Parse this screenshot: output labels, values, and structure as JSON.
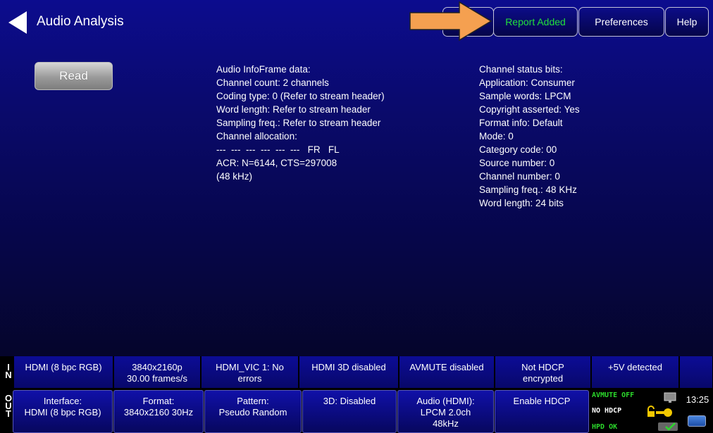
{
  "header": {
    "title": "Audio Analysis",
    "tabs": [
      {
        "label": ""
      },
      {
        "label": "Report Added"
      },
      {
        "label": "Preferences"
      },
      {
        "label": "Help"
      }
    ]
  },
  "read_button": "Read",
  "infoframe_lines": [
    "Audio InfoFrame data:",
    "Channel count: 2 channels",
    "Coding type: 0 (Refer to stream header)",
    "Word length: Refer to stream header",
    "Sampling freq.: Refer to stream header",
    "Channel allocation:",
    "---  ---  ---  ---  ---  ---   FR   FL",
    "ACR: N=6144, CTS=297008",
    "(48 kHz)"
  ],
  "channel_status_lines": [
    "Channel status bits:",
    "Application: Consumer",
    "Sample words: LPCM",
    "Copyright asserted: Yes",
    "Format info: Default",
    "Mode: 0",
    "Category code: 00",
    "Source number: 0",
    "Channel number: 0",
    "Sampling freq.: 48 KHz",
    "Word length: 24 bits"
  ],
  "in_bar": {
    "side_label": [
      "I",
      "N"
    ],
    "cells": [
      [
        "HDMI (8 bpc RGB)"
      ],
      [
        "3840x2160p",
        "30.00 frames/s"
      ],
      [
        "HDMI_VIC 1: No",
        "errors"
      ],
      [
        "HDMI 3D disabled"
      ],
      [
        "AVMUTE disabled"
      ],
      [
        "Not HDCP",
        "encrypted"
      ],
      [
        "+5V detected"
      ]
    ]
  },
  "out_bar": {
    "side_label": [
      "O",
      "U",
      "T"
    ],
    "cells": [
      [
        "Interface:",
        "HDMI (8 bpc RGB)"
      ],
      [
        "Format:",
        "3840x2160 30Hz"
      ],
      [
        "Pattern:",
        "Pseudo Random"
      ],
      [
        "3D: Disabled"
      ],
      [
        "Audio (HDMI):",
        "LPCM 2.0ch",
        "48kHz"
      ],
      [
        "Enable HDCP"
      ]
    ],
    "status": {
      "avmute": "AVMUTE OFF",
      "hdcp": "NO HDCP",
      "hpd": "HPD OK"
    },
    "clock": "13:25"
  },
  "colors": {
    "report_tab_text": "#22e03a",
    "arrow": "#f5a050",
    "status_green": "#2bd82b"
  },
  "icons": [
    "back-arrow-icon",
    "monitor-icon",
    "lock-key-icon",
    "toggle-check-icon",
    "clock-icon"
  ]
}
